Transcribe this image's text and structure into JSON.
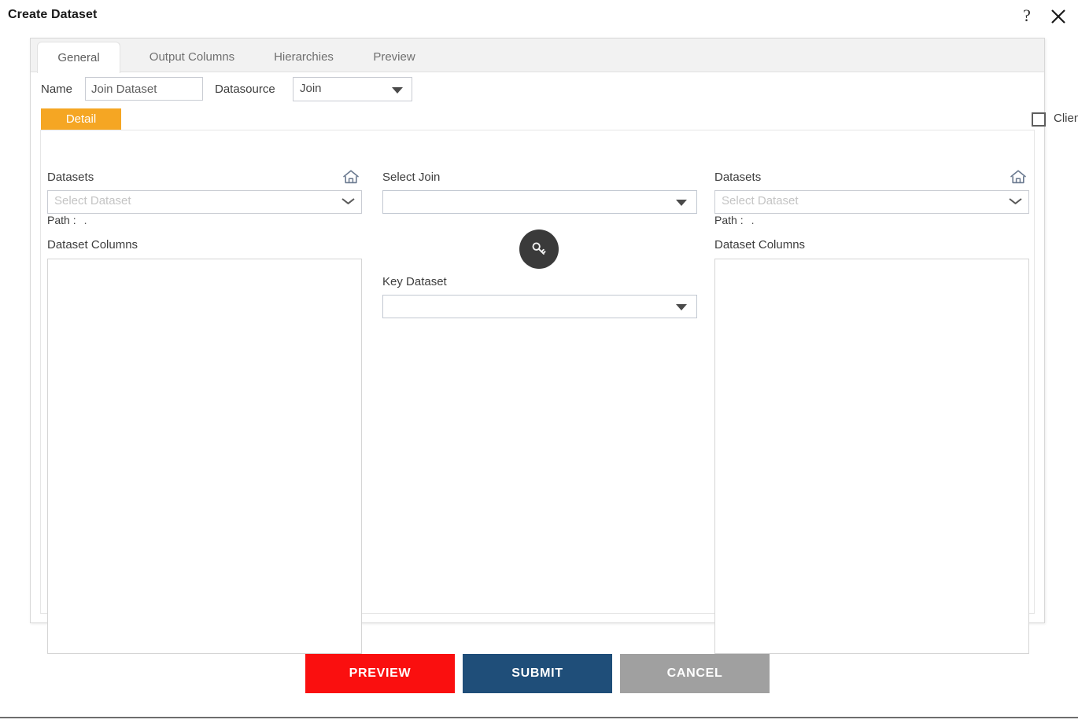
{
  "window": {
    "title": "Create Dataset",
    "help_icon": "question-mark-icon",
    "close_icon": "close-icon"
  },
  "tabs": [
    {
      "label": "General",
      "active": true
    },
    {
      "label": "Output Columns",
      "active": false
    },
    {
      "label": "Hierarchies",
      "active": false
    },
    {
      "label": "Preview",
      "active": false
    }
  ],
  "form": {
    "name_label": "Name",
    "name_value": "Join Dataset",
    "datasource_label": "Datasource",
    "datasource_value": "Join"
  },
  "detail_tab": {
    "label": "Detail"
  },
  "client_script": {
    "label": "Client Script",
    "checked": false
  },
  "left_panel": {
    "datasets_label": "Datasets",
    "home_icon": "home-icon",
    "dataset_placeholder": "Select Dataset",
    "dataset_value": "",
    "path_label": "Path :",
    "path_value": ".",
    "columns_label": "Dataset Columns",
    "columns": []
  },
  "center_panel": {
    "select_join_label": "Select Join",
    "select_join_value": "",
    "key_icon": "key-icon",
    "key_dataset_label": "Key Dataset",
    "key_dataset_value": ""
  },
  "right_panel": {
    "datasets_label": "Datasets",
    "home_icon": "home-icon",
    "dataset_placeholder": "Select Dataset",
    "dataset_value": "",
    "path_label": "Path :",
    "path_value": ".",
    "columns_label": "Dataset Columns",
    "columns": []
  },
  "footer": {
    "preview_label": "PREVIEW",
    "submit_label": "SUBMIT",
    "cancel_label": "CANCEL"
  },
  "colors": {
    "accent_orange": "#f5a623",
    "preview_red": "#fa0f0f",
    "submit_blue": "#1f4e79",
    "cancel_gray": "#a0a0a0",
    "key_badge_dark": "#3a3a3a"
  }
}
